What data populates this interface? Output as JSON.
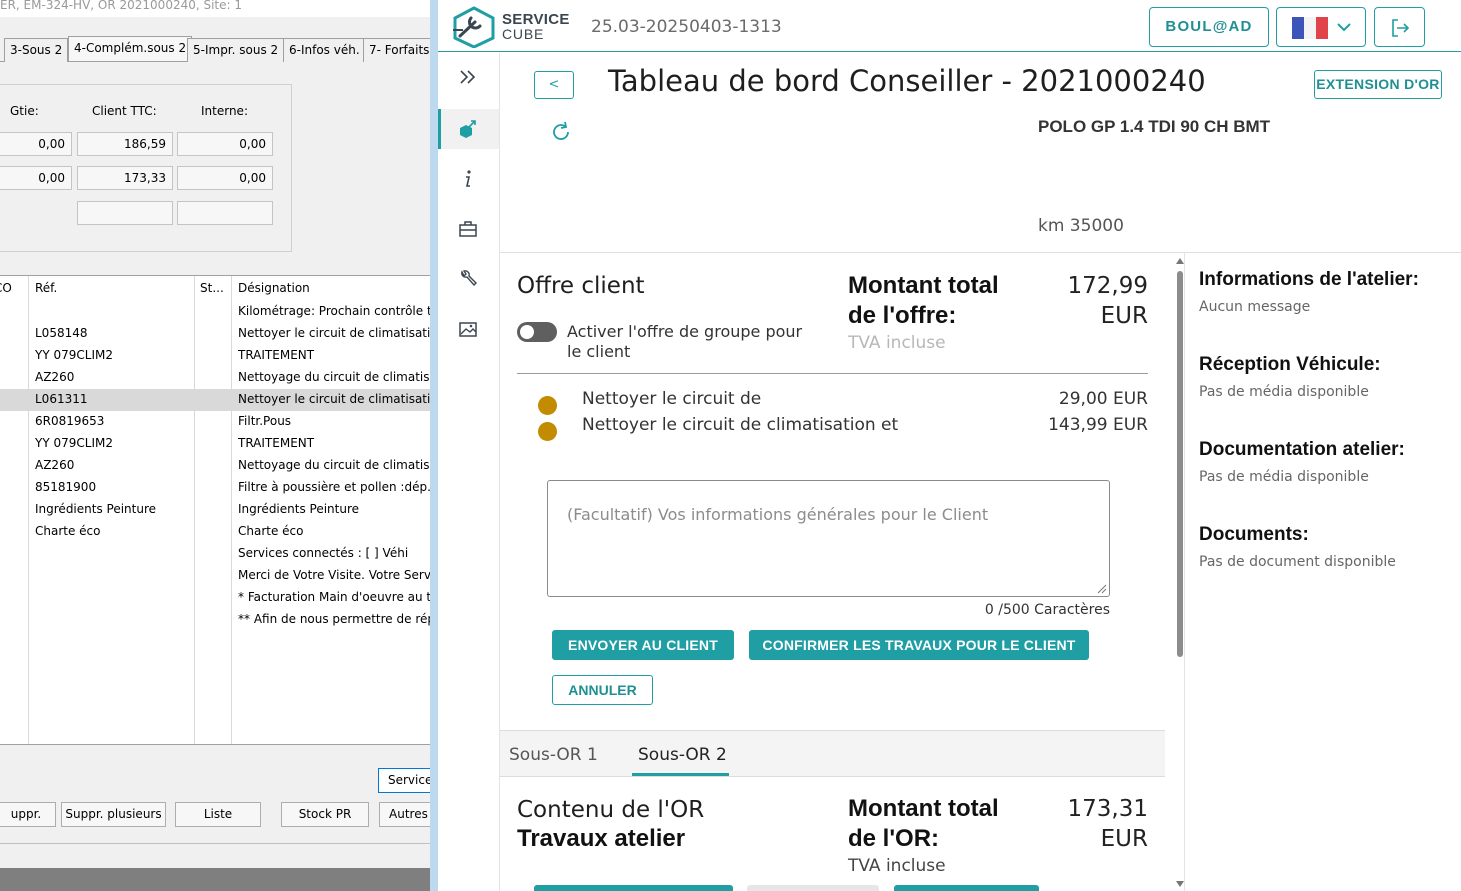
{
  "legacy": {
    "title": "ER, EM-324-HV, OR 2021000240, Site: 1",
    "tabs": [
      "3-Sous 2",
      "4-Complém.sous 2",
      "5-Impr. sous 2",
      "6-Infos véh.",
      "7- Forfaits"
    ],
    "totals": {
      "headers": [
        "Gtie:",
        "Client TTC:",
        "Interne:"
      ],
      "row1": [
        "0,00",
        "186,59",
        "0,00"
      ],
      "row2": [
        "0,00",
        "173,33",
        "0,00"
      ]
    },
    "grid": {
      "headers": [
        "CO",
        "Réf.",
        "St...",
        "Désignation"
      ],
      "rows": [
        {
          "ref": "",
          "des": "Kilométrage: Prochain contrôle te"
        },
        {
          "ref": "L058148",
          "des": "Nettoyer le circuit de climatisation"
        },
        {
          "ref": "YY 079CLIM2",
          "des": "TRAITEMENT"
        },
        {
          "ref": "AZ260",
          "des": "Nettoyage du circuit de climatisat"
        },
        {
          "ref": "L061311",
          "des": "Nettoyer le circuit de climatisation"
        },
        {
          "ref": "6R0819653",
          "des": "Filtr.Pous"
        },
        {
          "ref": "YY 079CLIM2",
          "des": "TRAITEMENT"
        },
        {
          "ref": "AZ260",
          "des": "Nettoyage du circuit de climatisat"
        },
        {
          "ref": "85181900",
          "des": "Filtre à poussière et pollen :dép.-"
        },
        {
          "ref": "Ingrédients Peinture",
          "des": "Ingrédients Peinture"
        },
        {
          "ref": "Charte éco",
          "des": "Charte éco"
        },
        {
          "ref": "",
          "des": "Services connectés : [    ]    Véhi"
        },
        {
          "ref": "",
          "des": "Merci de Votre Visite. Votre Servi"
        },
        {
          "ref": "",
          "des": "* Facturation Main d'oeuvre au te"
        },
        {
          "ref": "",
          "des": "** Afin de nous permettre de rép"
        }
      ]
    },
    "buttons": {
      "service": "Service",
      "suppr": "uppr.",
      "suppr_plusieurs": "Suppr. plusieurs",
      "liste": "Liste",
      "stock_pr": "Stock PR",
      "autres": "Autres"
    }
  },
  "app": {
    "logo_line1": "SERVICE",
    "logo_line2": "CUBE",
    "version": "25.03-20250403-1313",
    "boulad_label": "BOUL@AD",
    "page_title": "Tableau de bord Conseiller - 2021000240",
    "back_label": "<",
    "extension_label": "EXTENSION D'OR",
    "vehicle": "POLO GP 1.4 TDI 90 CH BMT",
    "km": "km 35000",
    "offre": {
      "title": "Offre client",
      "total_label_1": "Montant total",
      "total_label_2": "de l'offre:",
      "total_amount": "172,99",
      "total_currency": "EUR",
      "tva": "TVA incluse",
      "toggle_label": "Activer l'offre de groupe pour le client",
      "items": [
        {
          "label": "Nettoyer le circuit de",
          "amount": "29,00 EUR"
        },
        {
          "label": "Nettoyer le circuit de climatisation et",
          "amount": "143,99 EUR"
        }
      ],
      "placeholder": "(Facultatif) Vos informations générales pour le Client",
      "counter": "0 /500 Caractères",
      "btn_send": "ENVOYER AU CLIENT",
      "btn_confirm": "CONFIRMER LES TRAVAUX POUR LE CLIENT",
      "btn_cancel": "ANNULER"
    },
    "subtabs": [
      "Sous-OR 1",
      "Sous-OR 2"
    ],
    "or": {
      "title": "Contenu de l'OR",
      "subtitle": "Travaux atelier",
      "total_label_1": "Montant total",
      "total_label_2": "de l'OR:",
      "total_amount": "173,31",
      "total_currency": "EUR",
      "tva": "TVA incluse"
    },
    "info": [
      {
        "heading": "Informations de l'atelier:",
        "value": "Aucun message"
      },
      {
        "heading": "Réception Véhicule:",
        "value": "Pas de média disponible"
      },
      {
        "heading": "Documentation atelier:",
        "value": "Pas de média disponible"
      },
      {
        "heading": "Documents:",
        "value": "Pas de document disponible"
      }
    ],
    "colors": {
      "accent": "#1f9ea3",
      "dot": "#c28b00"
    }
  }
}
